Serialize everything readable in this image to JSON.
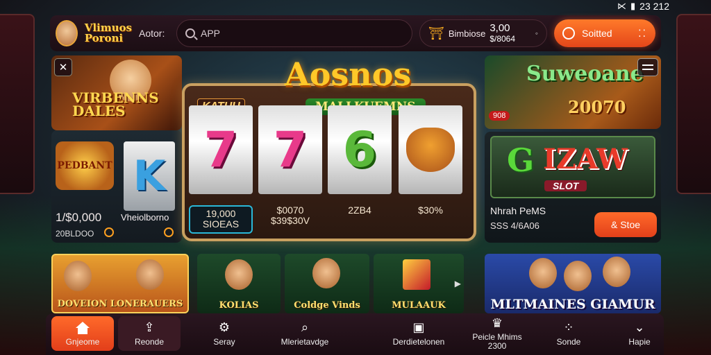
{
  "statusbar": {
    "signal_icon": "signal-icon",
    "battery_icon": "battery-icon",
    "time": "23 212"
  },
  "header": {
    "logo": "Vlimuos Poroni",
    "action": "Aotor:",
    "search": {
      "placeholder": "APP"
    },
    "balance": {
      "label": "Bimbiose",
      "value": "3,00",
      "sub": "$/8064"
    },
    "cta": {
      "label": "Soitted"
    }
  },
  "left": {
    "promo": {
      "title": "VIRBENNS DALES"
    },
    "jackpot": {
      "badge": "PEDBANT",
      "symbol": "K",
      "amount": "1/$0,000",
      "sub": "20BLDOO",
      "right": "Vheiolborno"
    }
  },
  "slot": {
    "title": "Aosnos",
    "subtitle": "MALLKUEMNS",
    "tag": "KATUU",
    "reels": [
      {
        "symbol": "7",
        "label": "19,000 SIOEAS"
      },
      {
        "symbol": "7",
        "label": "$0070 $39$30V"
      },
      {
        "symbol": "6",
        "label": "2ZB4"
      },
      {
        "symbol": "bull",
        "label": "$30%"
      }
    ]
  },
  "right": {
    "salon": {
      "title": "Suweoane",
      "year": "20070",
      "badge": "908"
    },
    "slot_card": {
      "g": "G",
      "word": "IZAW",
      "tag": "SLOT",
      "name": "Nhrah PeMS",
      "stat": "SSS 4/6A06",
      "play": "& Stoe"
    }
  },
  "games": [
    {
      "label": "DOVEION LONERAUERS"
    },
    {
      "label": "KOLIAS"
    },
    {
      "label": "Coldge Vinds"
    },
    {
      "label": "MULAAUK"
    },
    {
      "label": "MLTMAINES GIAMUR"
    }
  ],
  "nav": [
    {
      "label": "Gnjeome",
      "icon": "home-icon"
    },
    {
      "label": "Reonde",
      "icon": "upload-icon"
    },
    {
      "label": "Seray",
      "icon": "gear-icon"
    },
    {
      "label": "Mlerietavdge",
      "icon": "search-icon"
    },
    {
      "label": "Derdietelonen",
      "icon": "card-icon"
    },
    {
      "label": "Peicle Mhims 2300",
      "icon": "crown-icon"
    },
    {
      "label": "Sonde",
      "icon": "dots-icon"
    },
    {
      "label": "Hapie",
      "icon": "chevron-down-icon"
    }
  ]
}
